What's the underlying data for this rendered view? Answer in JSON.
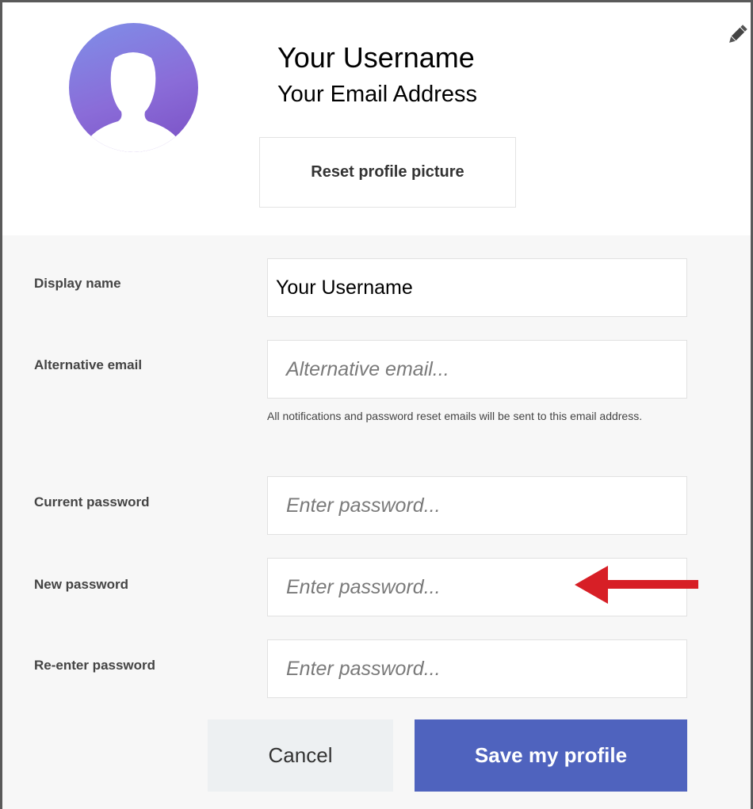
{
  "profile": {
    "username": "Your Username",
    "email": "Your Email Address",
    "reset_picture_label": "Reset profile picture",
    "avatar_icon": "user-silhouette-icon",
    "edit_icon": "pencil-icon"
  },
  "form": {
    "display_name": {
      "label": "Display name",
      "value": "Your Username"
    },
    "alternative_email": {
      "label": "Alternative email",
      "placeholder": "Alternative email...",
      "help_text": "All notifications and password reset emails will be sent to this email address."
    },
    "current_password": {
      "label": "Current password",
      "placeholder": "Enter password..."
    },
    "new_password": {
      "label": "New password",
      "placeholder": "Enter password..."
    },
    "reenter_password": {
      "label": "Re-enter password",
      "placeholder": "Enter password..."
    }
  },
  "actions": {
    "cancel_label": "Cancel",
    "save_label": "Save my profile"
  },
  "annotation": {
    "arrow_icon": "left-arrow-icon"
  },
  "colors": {
    "accent": "#4f63be",
    "annotation_red": "#d71f26",
    "avatar_gradient_start": "#7f8fe8",
    "avatar_gradient_end": "#7a4fc4"
  }
}
